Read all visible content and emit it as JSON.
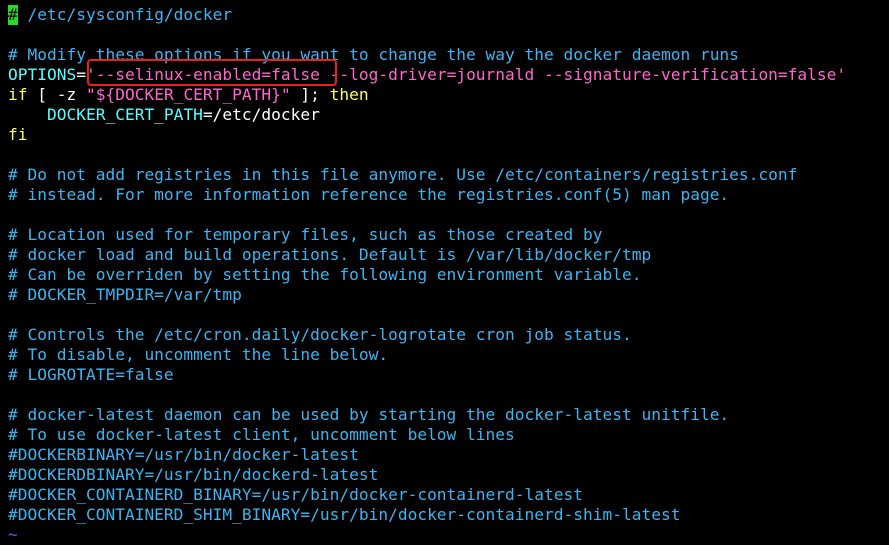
{
  "editor": {
    "lines": [
      {
        "parts": [
          {
            "cls": "cursor",
            "t": "#"
          },
          {
            "cls": "cmt",
            "t": " /etc/sysconfig/docker"
          }
        ]
      },
      {
        "parts": []
      },
      {
        "parts": [
          {
            "cls": "cmt",
            "t": "# Modify these options if you want to change the way the docker daemon runs"
          }
        ]
      },
      {
        "parts": [
          {
            "cls": "id",
            "t": "OPTIONS"
          },
          {
            "cls": "op",
            "t": "="
          },
          {
            "cls": "str",
            "t": "'--selinux-enabled=false --log-driver=journald --signature-verification=false'"
          }
        ]
      },
      {
        "parts": [
          {
            "cls": "kw",
            "t": "if"
          },
          {
            "cls": "op",
            "t": " [ -z "
          },
          {
            "cls": "str",
            "t": "\"${DOCKER_CERT_PATH}\""
          },
          {
            "cls": "op",
            "t": " ]; "
          },
          {
            "cls": "kw",
            "t": "then"
          }
        ]
      },
      {
        "parts": [
          {
            "cls": "id",
            "t": "    DOCKER_CERT_PATH"
          },
          {
            "cls": "op",
            "t": "=/etc/docker"
          }
        ]
      },
      {
        "parts": [
          {
            "cls": "kw",
            "t": "fi"
          }
        ]
      },
      {
        "parts": []
      },
      {
        "parts": [
          {
            "cls": "cmt",
            "t": "# Do not add registries in this file anymore. Use /etc/containers/registries.conf"
          }
        ]
      },
      {
        "parts": [
          {
            "cls": "cmt",
            "t": "# instead. For more information reference the registries.conf(5) man page."
          }
        ]
      },
      {
        "parts": []
      },
      {
        "parts": [
          {
            "cls": "cmt",
            "t": "# Location used for temporary files, such as those created by"
          }
        ]
      },
      {
        "parts": [
          {
            "cls": "cmt",
            "t": "# docker load and build operations. Default is /var/lib/docker/tmp"
          }
        ]
      },
      {
        "parts": [
          {
            "cls": "cmt",
            "t": "# Can be overriden by setting the following environment variable."
          }
        ]
      },
      {
        "parts": [
          {
            "cls": "cmt",
            "t": "# DOCKER_TMPDIR=/var/tmp"
          }
        ]
      },
      {
        "parts": []
      },
      {
        "parts": [
          {
            "cls": "cmt",
            "t": "# Controls the /etc/cron.daily/docker-logrotate cron job status."
          }
        ]
      },
      {
        "parts": [
          {
            "cls": "cmt",
            "t": "# To disable, uncomment the line below."
          }
        ]
      },
      {
        "parts": [
          {
            "cls": "cmt",
            "t": "# LOGROTATE=false"
          }
        ]
      },
      {
        "parts": []
      },
      {
        "parts": [
          {
            "cls": "cmt",
            "t": "# docker-latest daemon can be used by starting the docker-latest unitfile."
          }
        ]
      },
      {
        "parts": [
          {
            "cls": "cmt",
            "t": "# To use docker-latest client, uncomment below lines"
          }
        ]
      },
      {
        "parts": [
          {
            "cls": "cmt",
            "t": "#DOCKERBINARY=/usr/bin/docker-latest"
          }
        ]
      },
      {
        "parts": [
          {
            "cls": "cmt",
            "t": "#DOCKERDBINARY=/usr/bin/dockerd-latest"
          }
        ]
      },
      {
        "parts": [
          {
            "cls": "cmt",
            "t": "#DOCKER_CONTAINERD_BINARY=/usr/bin/docker-containerd-latest"
          }
        ]
      },
      {
        "parts": [
          {
            "cls": "cmt",
            "t": "#DOCKER_CONTAINERD_SHIM_BINARY=/usr/bin/docker-containerd-shim-latest"
          }
        ]
      },
      {
        "parts": [
          {
            "cls": "tilde",
            "t": "~"
          }
        ]
      }
    ]
  },
  "colors": {
    "background": "#000000",
    "comment": "#3db4f2",
    "keyword": "#ffff55",
    "identifier": "#55ffff",
    "string": "#ff66cc",
    "cursor": "#22dd22",
    "highlight_box": "#e8211b"
  }
}
